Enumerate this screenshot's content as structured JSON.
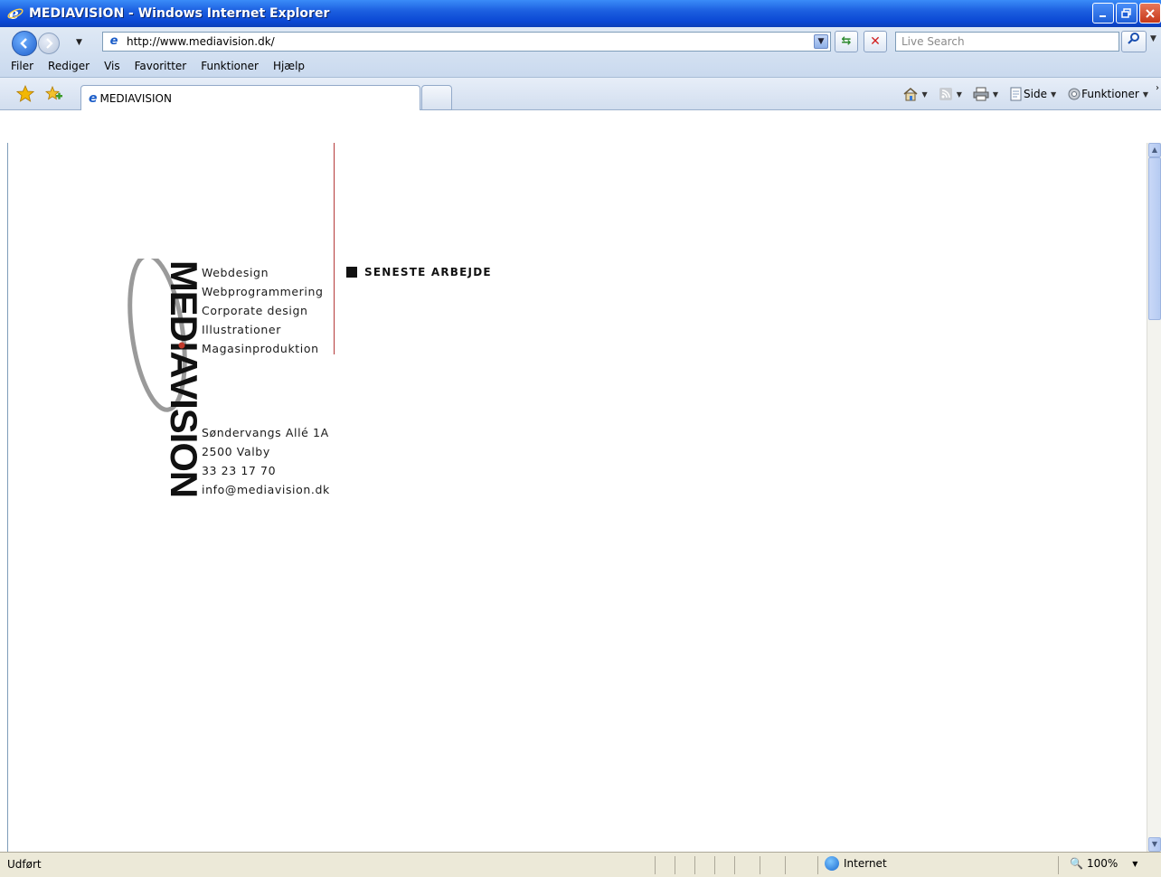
{
  "window": {
    "title": "MEDIAVISION - Windows Internet Explorer"
  },
  "address_bar": {
    "url": "http://www.mediavision.dk/",
    "search_placeholder": "Live Search"
  },
  "menu": {
    "items": [
      "Filer",
      "Rediger",
      "Vis",
      "Favoritter",
      "Funktioner",
      "Hjælp"
    ]
  },
  "tabs": {
    "active_label": "MEDIAVISION"
  },
  "command_bar": {
    "side_label": "Side",
    "tools_label": "Funktioner"
  },
  "page": {
    "services": [
      "Webdesign",
      "Webprogrammering",
      "Corporate design",
      "Illustrationer",
      "Magasinproduktion"
    ],
    "latest_label": "SENESTE ARBEJDE",
    "address_lines": [
      "Søndervangs Allé 1A",
      "2500 Valby",
      "33 23 17 70",
      "info@mediavision.dk"
    ],
    "logo_text": "MEDIAVISION",
    "accent_color": "#b43a3a"
  },
  "status_bar": {
    "status": "Udført",
    "zone": "Internet",
    "zoom": "100%"
  }
}
